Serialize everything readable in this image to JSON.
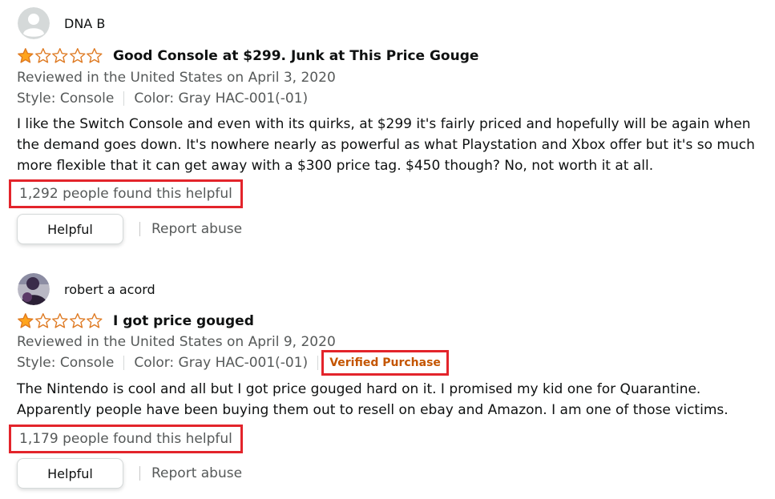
{
  "reviews": [
    {
      "author": "DNA B",
      "avatar": "default-avatar-icon",
      "rating": 1,
      "rating_max": 5,
      "title": "Good Console at $299. Junk at This Price Gouge",
      "date": "Reviewed in the United States on April 3, 2020",
      "style": "Style: Console",
      "color": "Color: Gray HAC-001(-01)",
      "verified": "",
      "body": "I like the Switch Console and even with its quirks, at $299 it's fairly priced and hopefully will be again when the demand goes down. It's nowhere nearly as powerful as what Playstation and Xbox offer but it's so much more flexible that it can get away with a $300 price tag. $450 though? No, not worth it at all.",
      "helpful_count": "1,292 people found this helpful",
      "helpful_button": "Helpful",
      "report": "Report abuse"
    },
    {
      "author": "robert a acord",
      "avatar": "user-photo-avatar",
      "rating": 1,
      "rating_max": 5,
      "title": "I got price gouged",
      "date": "Reviewed in the United States on April 9, 2020",
      "style": "Style: Console",
      "color": "Color: Gray HAC-001(-01)",
      "verified": "Verified Purchase",
      "body": "The Nintendo is cool and all but I got price gouged hard on it. I promised my kid one for Quarantine. Apparently people have been buying them out to resell on ebay and Amazon. I am one of those victims.",
      "helpful_count": "1,179 people found this helpful",
      "helpful_button": "Helpful",
      "report": "Report abuse"
    }
  ],
  "colors": {
    "star_fill": "#ffa41c",
    "star_outline": "#de7921",
    "highlight_box": "#e3242b",
    "verified": "#c45500",
    "secondary_text": "#565959"
  }
}
